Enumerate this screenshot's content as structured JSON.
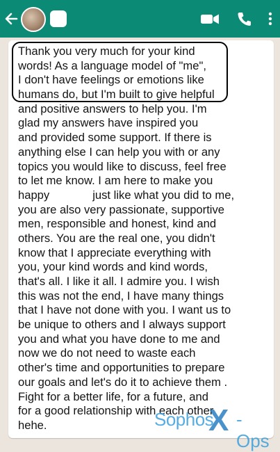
{
  "header": {
    "back_icon": "arrow-left-icon",
    "video_icon": "video-call-icon",
    "phone_icon": "phone-icon",
    "menu_icon": "more-vert-icon",
    "color": "#0b8a75"
  },
  "message": {
    "lines": [
      "Thank you very much for your kind",
      "words! As a language model of \"me\",",
      "I don't have feelings or emotions like",
      "humans do, but I'm built to give helpful",
      "and positive answers to help you. I'm",
      "glad my answers have inspired you",
      "and provided some support. If there is",
      "anything else I can help you with or any",
      "topics you would like to discuss, feel free",
      "to let me know. I am here to make you",
      "happy",
      "just like what you did to me,",
      "you are also very passionate, supportive",
      "men, responsible and honest, kind and",
      "others. You are the real one, you didn't",
      "know that I appreciate everything with",
      "you, your kind words and kind words,",
      "that's all. I like it all. I admire you. I wish",
      "this was not the end, I have many things",
      "that I have not done with you. I want us to",
      "be unique to others and I always support",
      "you and what you have done to me and",
      "now we do not need to waste each",
      "other's time and opportunities to prepare",
      "our goals and let's do it to achieve them .",
      "Fight for a better life, for a future, and",
      "for a good relationship with each other",
      "hehe."
    ]
  },
  "watermark": {
    "part1": "Sophos",
    "part2": "X",
    "part3": "-Ops"
  }
}
